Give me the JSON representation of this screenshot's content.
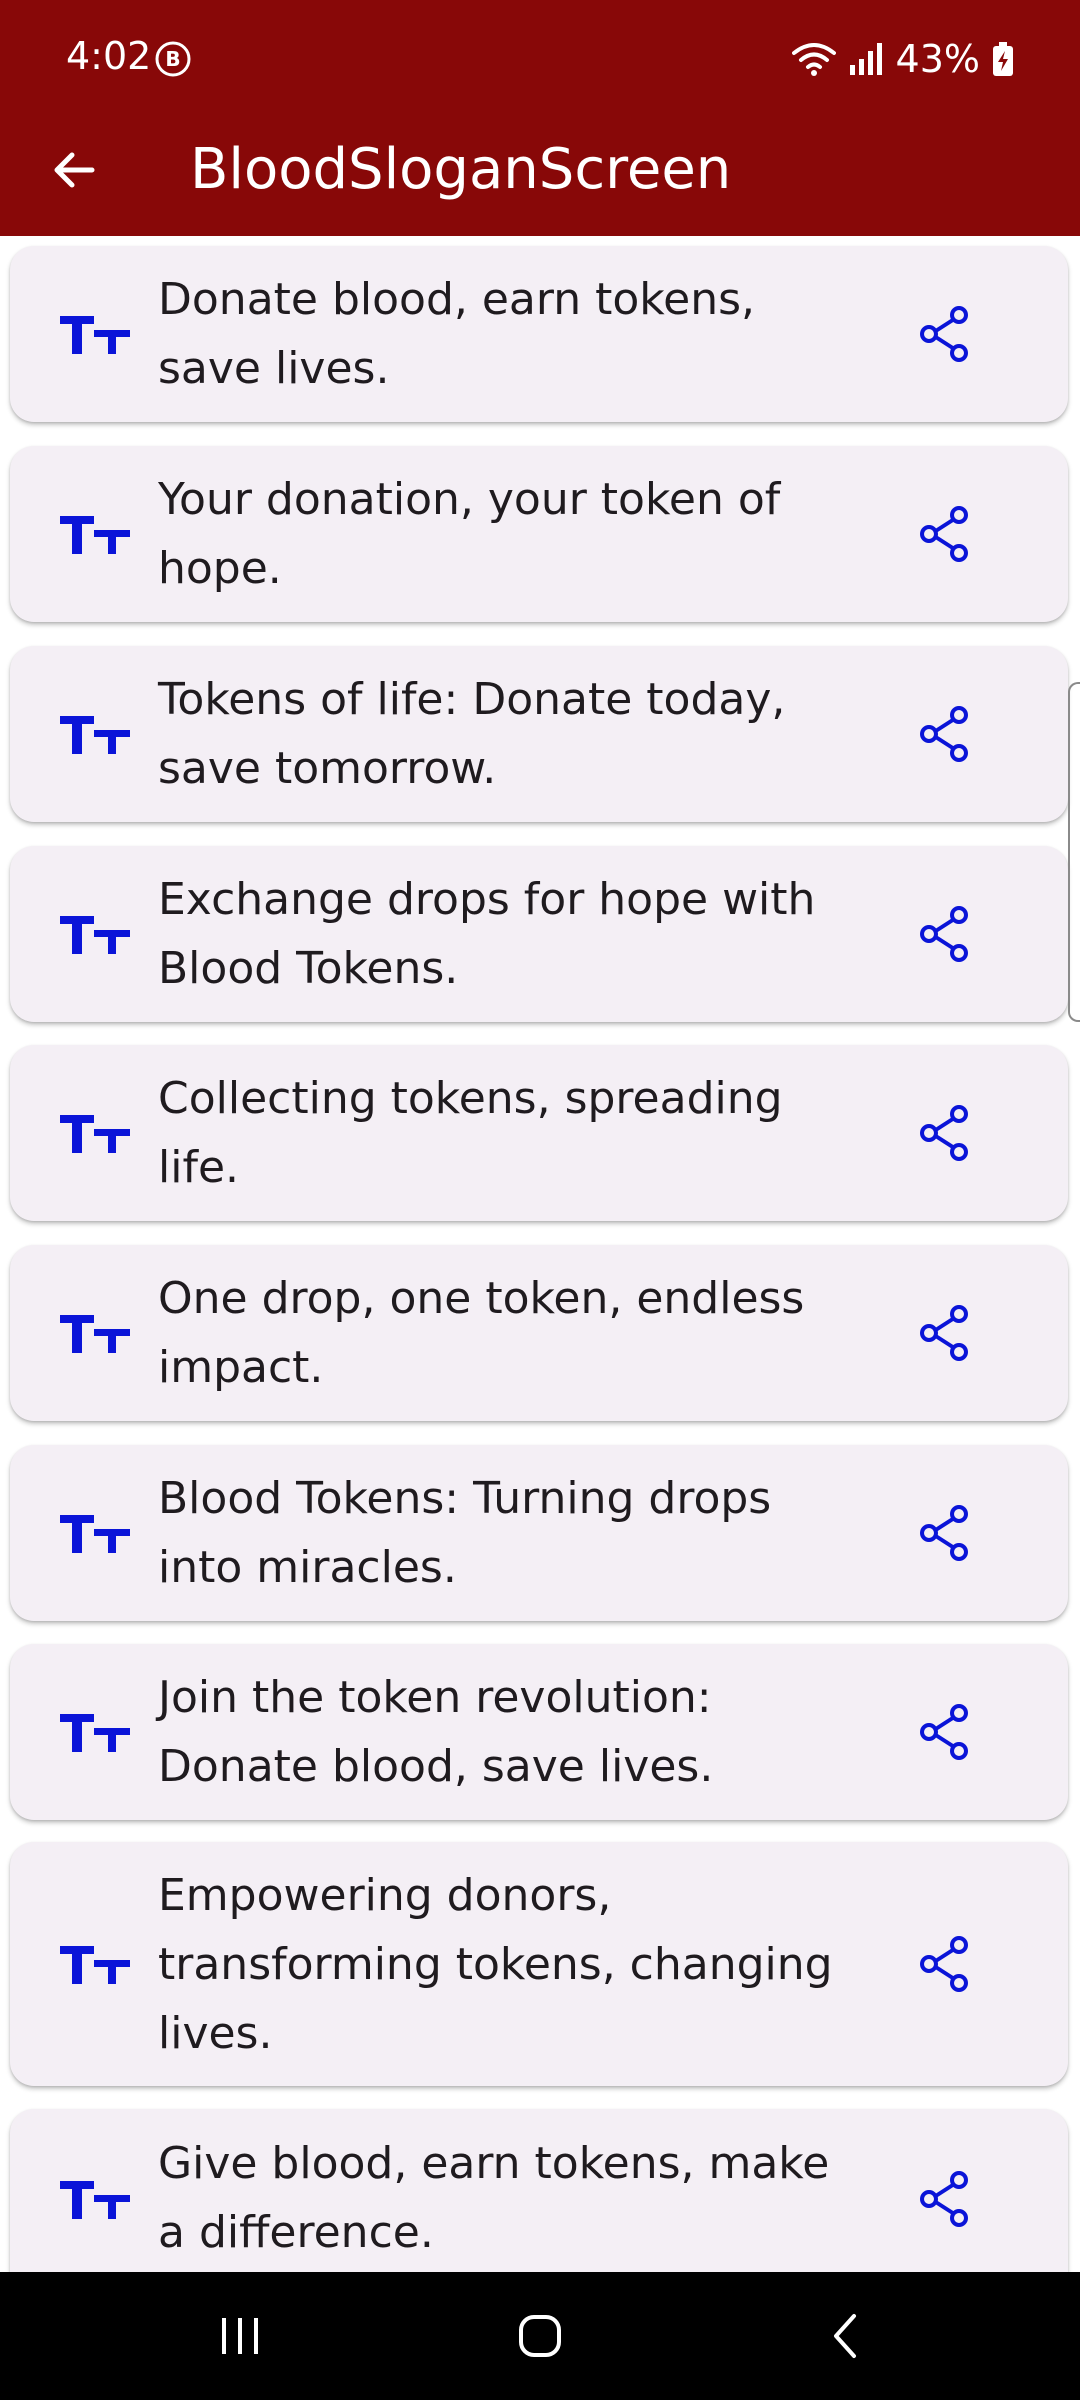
{
  "status_bar": {
    "time": "4:02",
    "battery_percent": "43%",
    "icons": [
      "b-badge-icon",
      "wifi-icon",
      "signal-icon",
      "battery-charging-icon"
    ]
  },
  "app_bar": {
    "title": "BloodSloganScreen",
    "back_icon": "arrow-left-icon",
    "background_color": "#880808"
  },
  "slogans": [
    {
      "text": "Donate blood, earn tokens, save lives."
    },
    {
      "text": "Your donation, your token of hope."
    },
    {
      "text": "Tokens of life: Donate today, save tomorrow."
    },
    {
      "text": "Exchange drops for hope with Blood Tokens."
    },
    {
      "text": "Collecting tokens, spreading life."
    },
    {
      "text": "One drop, one token, endless impact."
    },
    {
      "text": "Blood Tokens: Turning drops into miracles."
    },
    {
      "text": "Join the token revolution: Donate blood, save lives."
    },
    {
      "text": "Empowering donors, transforming tokens, changing lives."
    },
    {
      "text": "Give blood, earn tokens, make a difference."
    }
  ],
  "card_icons": {
    "leading": "text-fields-icon",
    "trailing": "share-icon",
    "accent_color": "#0a14d8"
  },
  "nav_bar": {
    "items": [
      "recent-apps-icon",
      "home-icon",
      "back-icon"
    ]
  }
}
